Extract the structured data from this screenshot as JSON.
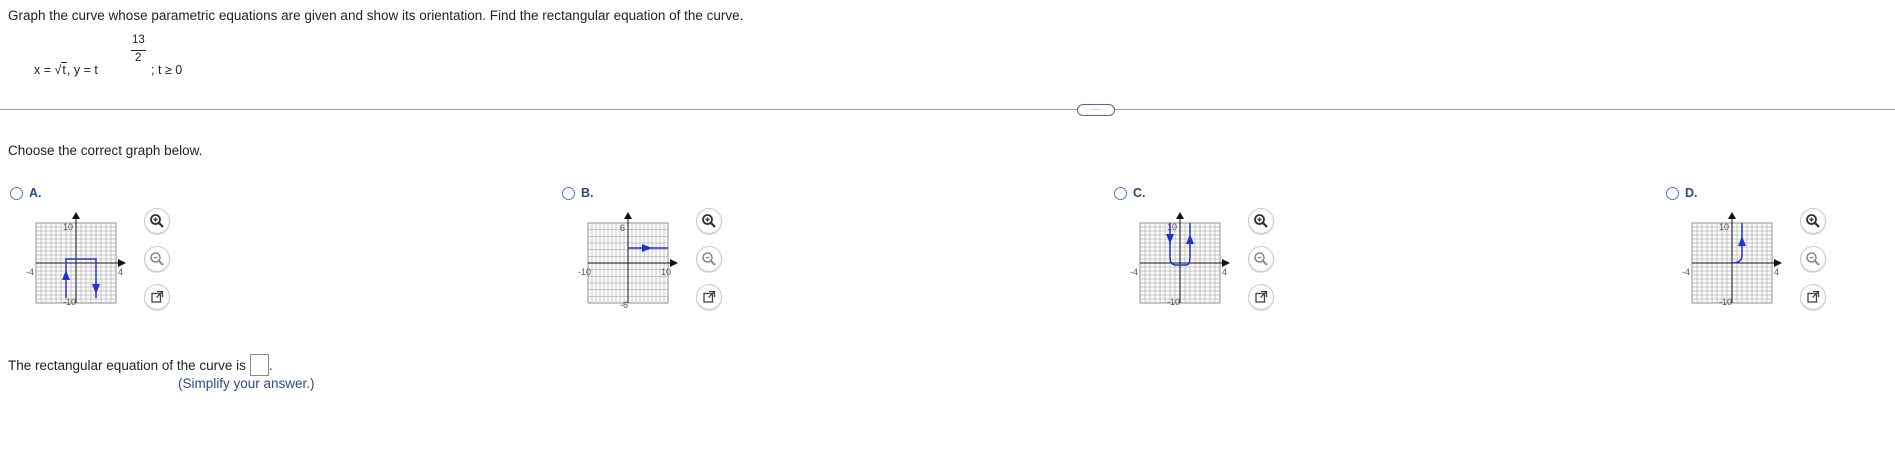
{
  "question": {
    "instruction": "Graph the curve whose parametric equations are given and show its orientation. Find the rectangular equation of the curve.",
    "equation": {
      "x_part": "x =",
      "radicand": "t",
      "comma": ",",
      "y_part": "y = t",
      "exp_num": "13",
      "exp_den": "2",
      "constraint": "; t ≥ 0"
    }
  },
  "more_button": "···",
  "prompt": "Choose the correct graph below.",
  "options": [
    {
      "label": "A.",
      "xmin": "-4",
      "xmax": "4",
      "ymax": "10",
      "ymin": "-10"
    },
    {
      "label": "B.",
      "xmin": "-10",
      "xmax": "10",
      "ymax": "6",
      "ymin": "-6"
    },
    {
      "label": "C.",
      "xmin": "-4",
      "xmax": "4",
      "ymax": "10",
      "ymin": "-10"
    },
    {
      "label": "D.",
      "xmin": "-4",
      "xmax": "4",
      "ymax": "10",
      "ymin": "-10"
    }
  ],
  "answer": {
    "text": "The rectangular equation of the curve is",
    "period": ".",
    "hint": "(Simplify your answer.)"
  },
  "colors": {
    "curve": "#2233cc",
    "accent": "#2a4a8a",
    "radio": "#4a78c2"
  },
  "icons": [
    "zoom-in-icon",
    "zoom-out-icon",
    "popout-icon"
  ]
}
